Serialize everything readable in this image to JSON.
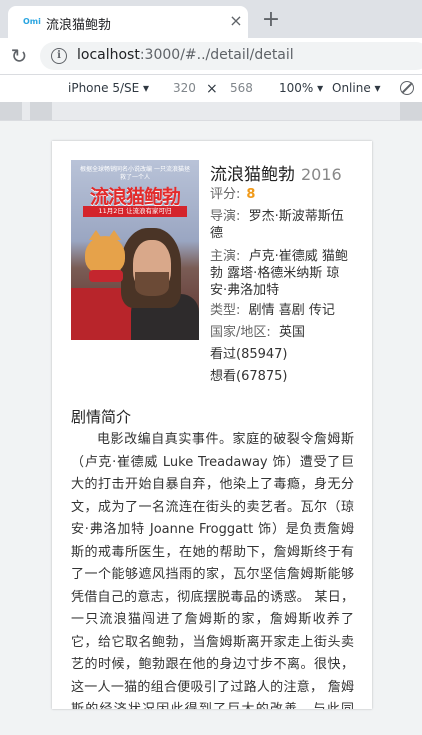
{
  "browser": {
    "tab_title": "流浪猫鲍勃",
    "favicon_text": "Omi",
    "tab_close": "×",
    "new_tab": "+",
    "reload": "↻",
    "info": "i",
    "url_host": "localhost",
    "url_rest": ":3000/#../detail/detail"
  },
  "device_toolbar": {
    "device": "iPhone 5/SE ▾",
    "width": "320",
    "times": "×",
    "height": "568",
    "zoom": "100% ▾",
    "network": "Online ▾"
  },
  "movie": {
    "poster_tagline": "根据全球畅销同名小说改编 一只流浪猫拯救了一个人",
    "poster_title": "流浪猫鲍勃",
    "poster_date": "11月2日 让流浪有家可归",
    "title": "流浪猫鲍勃",
    "year": "2016",
    "rating_label": "评分:",
    "rating": "8",
    "director_label": "导演:",
    "director": "罗杰·斯波蒂斯伍德",
    "cast_label": "主演:",
    "cast": "卢克·崔德威 猫鲍勃 露塔·格德米纳斯 琼安·弗洛加特",
    "genre_label": "类型:",
    "genre": "剧情 喜剧 传记",
    "country_label": "国家/地区:",
    "country": "英国",
    "watched": "看过(85947)",
    "want": "想看(67875)"
  },
  "synopsis": {
    "title": "剧情简介",
    "text": "电影改编自真实事件。家庭的破裂令詹姆斯（卢克·崔德威 Luke Treadaway 饰）遭受了巨大的打击开始自暴自弃，他染上了毒瘾，身无分文，成为了一名流连在街头的卖艺者。瓦尔（琼安·弗洛加特 Joanne Froggatt 饰）是负责詹姆斯的戒毒所医生，在她的帮助下，詹姆斯终于有了一个能够遮风挡雨的家，瓦尔坚信詹姆斯能够凭借自己的意志，彻底摆脱毒品的诱惑。 某日，一只流浪猫闯进了詹姆斯的家，詹姆斯收养了它，给它取名鲍勃，当詹姆斯离开家走上街头卖艺的时候，鲍勃跟在他的身边寸步不离。很快，这一人一猫的组合便吸引了过路人的注意， 詹姆斯的经济状况因此得到了巨大的改善，与此同时，詹姆斯结识了住在隔"
  }
}
